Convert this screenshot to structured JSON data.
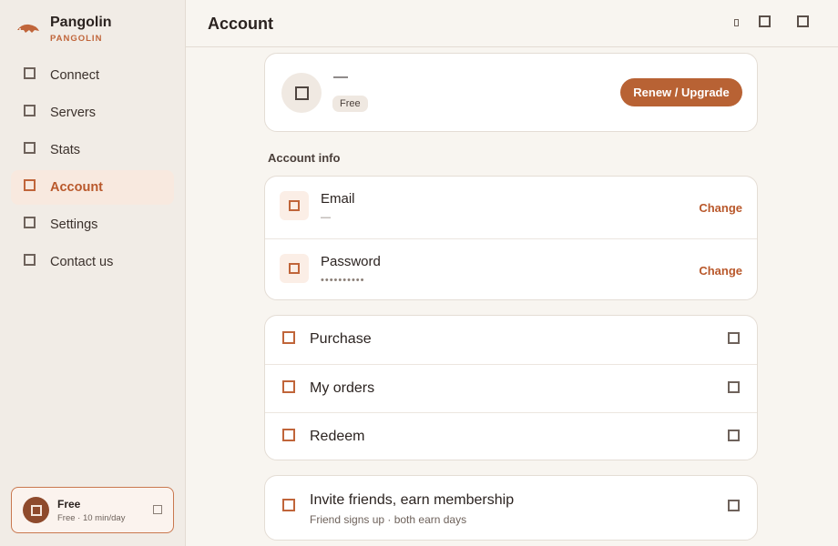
{
  "brand": {
    "name": "Pangolin",
    "subtitle": "PANGOLIN",
    "logo_icon": "pangolin-logo-icon"
  },
  "sidebar": {
    "items": [
      {
        "label": "Connect",
        "icon": "connect-icon"
      },
      {
        "label": "Servers",
        "icon": "servers-icon"
      },
      {
        "label": "Stats",
        "icon": "stats-icon"
      },
      {
        "label": "Account",
        "icon": "account-icon",
        "active": true
      },
      {
        "label": "Settings",
        "icon": "settings-icon"
      },
      {
        "label": "Contact us",
        "icon": "contact-icon"
      }
    ],
    "plan": {
      "title": "Free",
      "desc": "Free · 10 min/day"
    }
  },
  "header": {
    "title": "Account"
  },
  "profile": {
    "name": "—",
    "tier": "Free",
    "renew_label": "Renew / Upgrade"
  },
  "account_info": {
    "title": "Account info",
    "rows": [
      {
        "label": "Email",
        "value": "—",
        "action": "Change"
      },
      {
        "label": "Password",
        "value": "••••••••••",
        "action": "Change"
      }
    ]
  },
  "actions": [
    {
      "label": "Purchase"
    },
    {
      "label": "My orders"
    },
    {
      "label": "Redeem"
    }
  ],
  "invite": {
    "title": "Invite friends, earn membership",
    "subtitle": "Friend signs up · both earn days"
  },
  "colors": {
    "accent": "#b86234",
    "sidebar_bg": "#f1ece6",
    "page_bg": "#f8f5f0",
    "active_bg": "#f8e9df"
  }
}
